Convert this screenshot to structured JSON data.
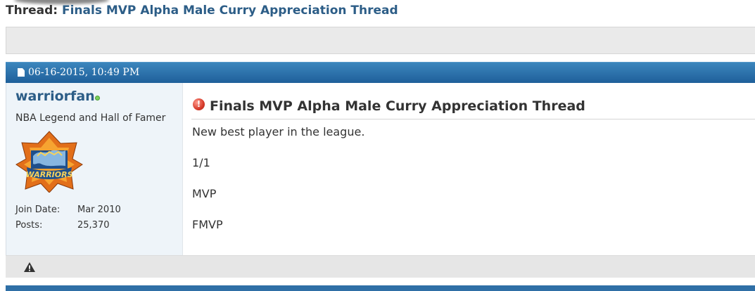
{
  "thread": {
    "prefix": "Thread:",
    "title": "Finals MVP Alpha Male Curry Appreciation Thread"
  },
  "post": {
    "date": "06-16-2015, 10:49 PM",
    "title": "Finals MVP Alpha Male Curry Appreciation Thread",
    "message_lines": [
      "New best player in the league.",
      "1/1",
      "MVP",
      "FMVP"
    ]
  },
  "user": {
    "username": "warriorfan",
    "status": "online",
    "title": "NBA Legend and Hall of Famer",
    "avatar_text": "WARRIORS",
    "stats": [
      {
        "label": "Join Date:",
        "value": "Mar 2010"
      },
      {
        "label": "Posts:",
        "value": "25,370"
      }
    ]
  },
  "icons": {
    "page": "page-icon",
    "online": "online-status-icon",
    "post_icon": "exclamation-icon",
    "report": "warning-triangle-icon"
  },
  "colors": {
    "link": "#2c5d87",
    "header_bar": "#2a6fad",
    "user_panel": "#eef4f9",
    "online": "#7bcf5c"
  }
}
